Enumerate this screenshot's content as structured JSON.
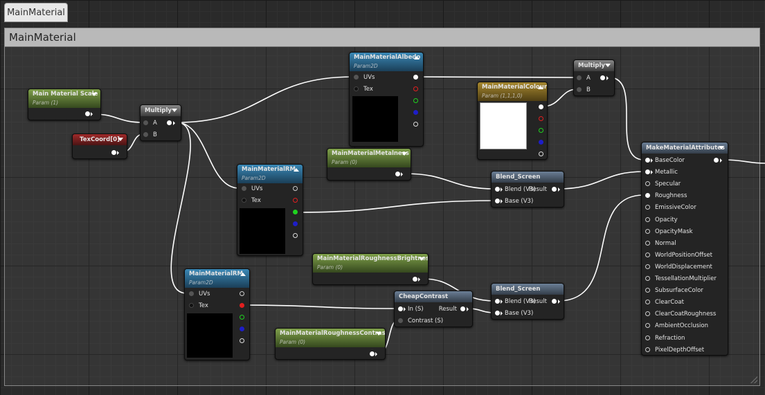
{
  "tab": {
    "title": "MainMaterial"
  },
  "comment": {
    "title": "MainMaterial"
  },
  "nodes": {
    "scale": {
      "title": "Main Material Scale",
      "subtitle": "Param (1)"
    },
    "texcoord": {
      "title": "TexCoord[0]"
    },
    "multiply1": {
      "title": "Multiply",
      "pin_a": "A",
      "pin_b": "B"
    },
    "albedo": {
      "title": "MainMaterialAlbedo",
      "subtitle": "Param2D",
      "uvs": "UVs",
      "tex": "Tex"
    },
    "colour": {
      "title": "MainMaterialColour",
      "subtitle": "Param (1,1,1,0)"
    },
    "multiply2": {
      "title": "Multiply",
      "pin_a": "A",
      "pin_b": "B"
    },
    "metalness": {
      "title": "MainMaterialMetalness",
      "subtitle": "Param (0)"
    },
    "rm1": {
      "title": "MainMaterialRM",
      "subtitle": "Param2D",
      "uvs": "UVs",
      "tex": "Tex"
    },
    "blend1": {
      "title": "Blend_Screen",
      "blend": "Blend (V3)",
      "result": "Result",
      "base": "Base (V3)"
    },
    "rbright": {
      "title": "MainMaterialRoughnessBrightness",
      "subtitle": "Param (0)"
    },
    "rm2": {
      "title": "MainMaterialRM",
      "subtitle": "Param2D",
      "uvs": "UVs",
      "tex": "Tex"
    },
    "cheap": {
      "title": "CheapContrast",
      "in": "In (S)",
      "result": "Result",
      "contrast": "Contrast (S)"
    },
    "blend2": {
      "title": "Blend_Screen",
      "blend": "Blend (V3)",
      "result": "Result",
      "base": "Base (V3)"
    },
    "rcontrast": {
      "title": "MainMaterialRoughnessContrast",
      "subtitle": "Param (0)"
    },
    "mma": {
      "title": "MakeMaterialAttributes",
      "pins": [
        "BaseColor",
        "Metallic",
        "Specular",
        "Roughness",
        "EmissiveColor",
        "Opacity",
        "OpacityMask",
        "Normal",
        "WorldPositionOffset",
        "WorldDisplacement",
        "TessellationMultiplier",
        "SubsurfaceColor",
        "ClearCoat",
        "ClearCoatRoughness",
        "AmbientOcclusion",
        "Refraction",
        "PixelDepthOffset"
      ]
    }
  },
  "colors": {
    "param_header": "#7fa04a",
    "texture_header": "#3a88b6",
    "vector_header": "#a6872e",
    "coord_header": "#a02a2a",
    "function_header": "#6b7f96",
    "wire": "#ffffff",
    "pin_red": "#e21f1f",
    "pin_green": "#1fd21f",
    "pin_blue": "#1e1ec8"
  }
}
